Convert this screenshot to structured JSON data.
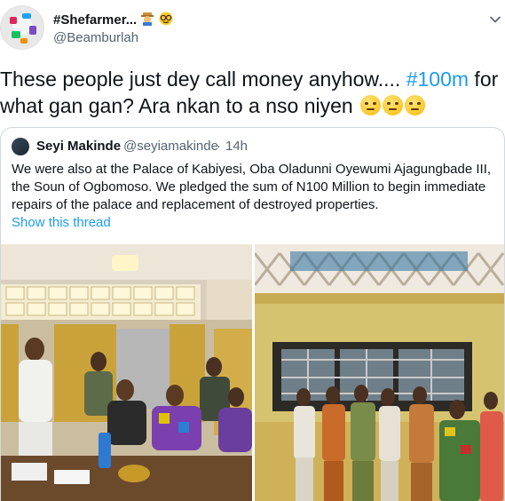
{
  "author": {
    "display_name": "#Shefarmer...",
    "handle": "@Beamburlah",
    "badge_icons": [
      "farmer-emoji-icon",
      "nerd-face-emoji-icon"
    ]
  },
  "tweet": {
    "text_before_hashtag": "These people just dey call money anyhow.... ",
    "hashtag": "#100m",
    "text_after_hashtag": " for what gan gan? Ara nkan to a nso niyen ",
    "emojis": [
      "face-with-rolling-eyes-icon",
      "smirking-face-icon",
      "smirking-face-icon"
    ]
  },
  "quoted_tweet": {
    "author_name": "Seyi Makinde",
    "author_handle": "@seyiamakinde",
    "separator": "·",
    "time": "14h",
    "text": "We were also at the Palace of Kabiyesi, Oba Oladunni Oyewumi Ajagungbade III, the Soun of Ogbomoso. We pledged the sum of N100 Million to begin immediate repairs of the palace and replacement of destroyed properties.",
    "show_thread": "Show this thread"
  },
  "colors": {
    "link_blue": "#1d9bf0",
    "secondary_text": "#536471",
    "border": "#cfd9de"
  }
}
